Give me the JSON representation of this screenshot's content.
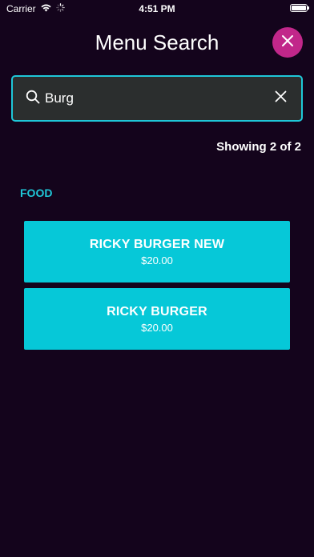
{
  "status_bar": {
    "carrier": "Carrier",
    "time": "4:51 PM"
  },
  "header": {
    "title": "Menu Search",
    "close_icon": "close-icon",
    "close_color": "#c1278a"
  },
  "search": {
    "value": "Burg",
    "placeholder": "",
    "search_icon": "search-icon",
    "clear_icon": "clear-icon",
    "border_color": "#1fc7d8"
  },
  "results": {
    "summary": "Showing 2 of 2",
    "section_title": "FOOD",
    "items": [
      {
        "name": "RICKY BURGER NEW",
        "price": "$20.00"
      },
      {
        "name": "RICKY BURGER",
        "price": "$20.00"
      }
    ],
    "accent_color": "#06c8d8"
  }
}
